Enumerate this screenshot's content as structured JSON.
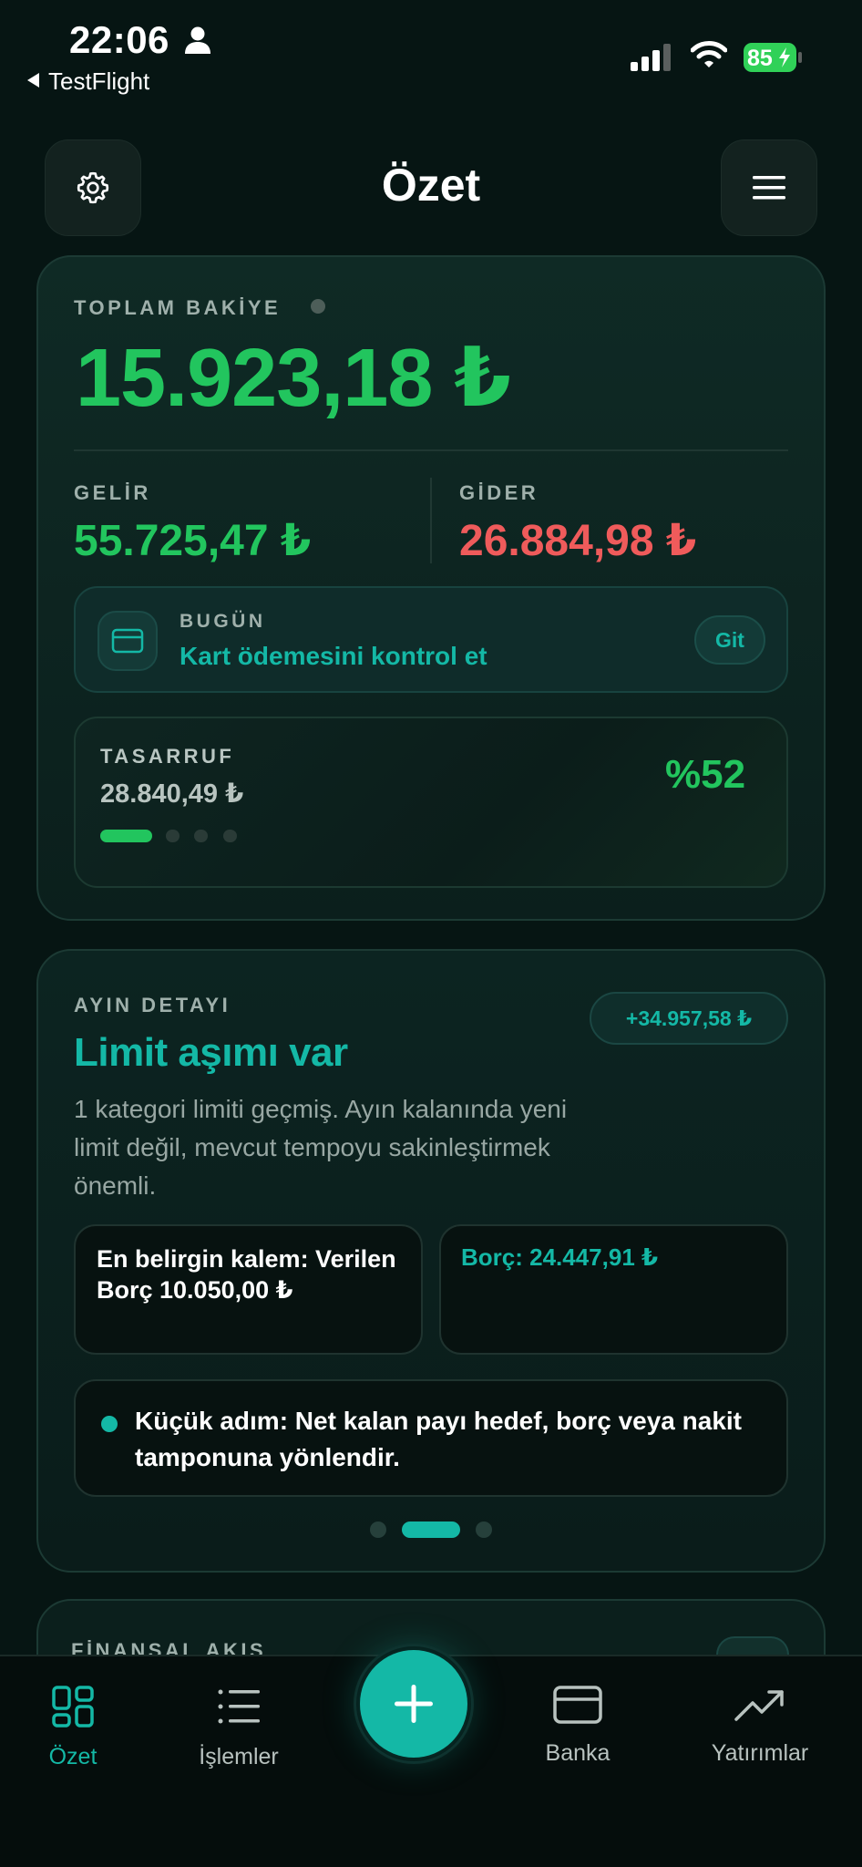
{
  "status_bar": {
    "time": "22:06",
    "back_app": "TestFlight",
    "battery": "85"
  },
  "header": {
    "title": "Özet",
    "left_icon": "gear-icon",
    "right_icon": "hamburger-menu-icon"
  },
  "balance_card": {
    "total_label": "TOPLAM BAKİYE",
    "total_value": "15.923,18 ₺",
    "income_label": "GELİR",
    "income_value": "55.725,47 ₺",
    "expense_label": "GİDER",
    "expense_value": "26.884,98 ₺",
    "today_label": "BUGÜN",
    "today_text": "Kart ödemesini kontrol et",
    "today_button": "Git",
    "savings_label": "TASARRUF",
    "savings_value": "28.840,49 ₺",
    "savings_percent": "%52",
    "pager_active_index": 0,
    "pager_count": 4
  },
  "month_card": {
    "label": "AYIN DETAYI",
    "badge": "+34.957,58 ₺",
    "title": "Limit aşımı var",
    "description": "1 kategori limiti geçmiş. Ayın kalanında yeni limit değil, mevcut tempoyu sakinleştirmek önemli.",
    "top_item": "En belirgin kalem: Verilen Borç 10.050,00 ₺",
    "debt": "Borç: 24.447,91 ₺",
    "tip": "Küçük adım: Net kalan payı hedef, borç veya nakit tamponuna yönlendir.",
    "pager_active_index": 1,
    "pager_count": 3
  },
  "flow_card": {
    "label": "FİNANSAL AKIŞ"
  },
  "nav": {
    "items": [
      {
        "label": "Özet",
        "icon": "dashboard-grid-icon",
        "active": true
      },
      {
        "label": "İşlemler",
        "icon": "list-icon",
        "active": false
      },
      {
        "label": "Banka",
        "icon": "credit-card-icon",
        "active": false
      },
      {
        "label": "Yatırımlar",
        "icon": "trending-up-icon",
        "active": false
      }
    ],
    "fab_icon": "plus-icon"
  },
  "colors": {
    "accent": "#14b8a6",
    "income": "#22c55e",
    "expense": "#ef5b5b",
    "background": "#061513"
  }
}
